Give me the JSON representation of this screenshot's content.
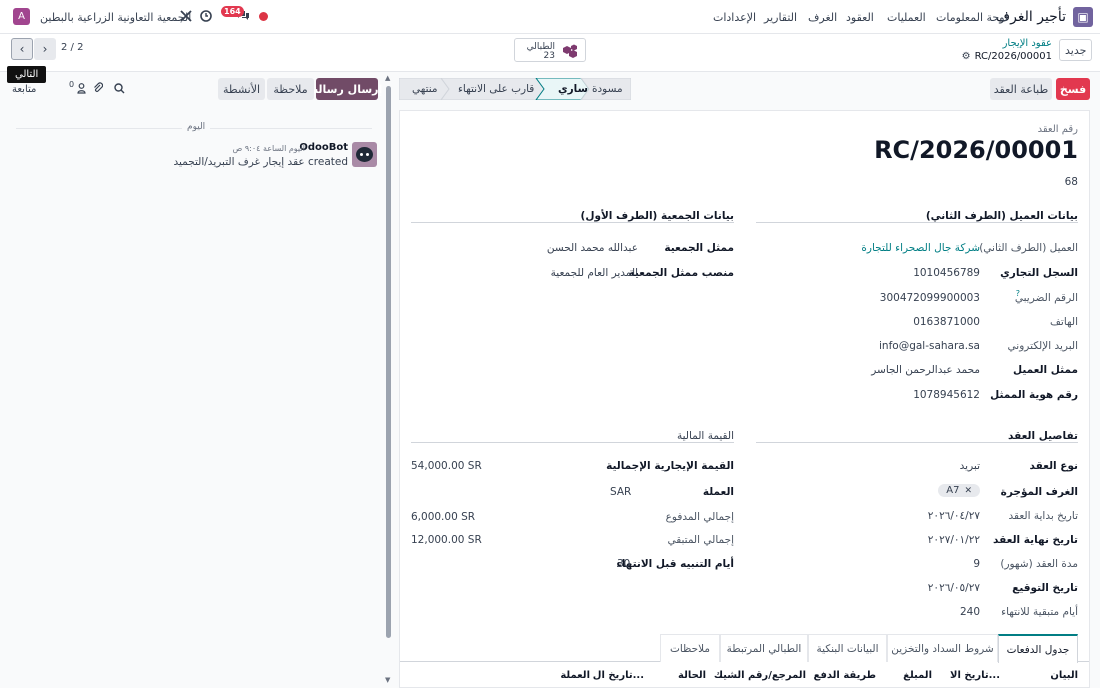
{
  "topbar": {
    "app_name": "تأجير الغرف",
    "menu": [
      "لوحة المعلومات",
      "العمليات",
      "العقود",
      "الغرف",
      "التقارير",
      "الإعدادات"
    ],
    "company": "الجمعية التعاونية الزراعية بالبطين",
    "user_initial": "A",
    "messages_count": "164"
  },
  "control": {
    "new_label": "جديد",
    "breadcrumb_parent": "عقود الإيجار",
    "record_name": "RC/2026/00001",
    "smart_button_label": "الطبالي",
    "smart_button_count": "23",
    "pager": "2 / 2",
    "tooltip": "التالي"
  },
  "actions": {
    "cancel": "فسخ",
    "print": "طباعة العقد",
    "stages": [
      "مسودة",
      "ساري",
      "قارب على الانتهاء",
      "منتهي"
    ],
    "active_stage": "ساري"
  },
  "chatter": {
    "send_message": "إرسال رسالة",
    "note": "ملاحظة",
    "activities": "الأنشطة",
    "follow": "متابعة",
    "followers_count": "0",
    "day_label": "اليوم",
    "author": "OdooBot",
    "time": "اليوم الساعة ٩:٠٤ ص",
    "message": "عقد إيجار غرف التبريد/التجميد created"
  },
  "form": {
    "number_label": "رقم العقد",
    "number": "RC/2026/00001",
    "sub_number": "68",
    "client_section": "بيانات العميل (الطرف الثاني)",
    "assoc_section": "بيانات الجمعية (الطرف الأول)",
    "client_fields": [
      {
        "label": "العميل (الطرف الثاني)",
        "value": "شركة جال الصحراء للتجارة",
        "bold": false
      },
      {
        "label": "السجل التجاري",
        "value": "1010456789",
        "bold": true
      },
      {
        "label": "الرقم الضريبي",
        "value": "300472099900003",
        "bold": false
      },
      {
        "label": "الهاتف",
        "value": "0163871000",
        "bold": false
      },
      {
        "label": "البريد الإلكتروني",
        "value": "info@gal-sahara.sa",
        "bold": false
      },
      {
        "label": "ممثل العميل",
        "value": "محمد عبدالرحمن الجاسر",
        "bold": true
      },
      {
        "label": "رقم هوية الممثل",
        "value": "1078945612",
        "bold": true
      }
    ],
    "tax_help": "?",
    "assoc_fields": [
      {
        "label": "ممثل الجمعية",
        "value": "عبدالله محمد الحسن"
      },
      {
        "label": "منصب ممثل الجمعية",
        "value": "المدير العام للجمعية"
      }
    ],
    "contract_section": "تفاصيل العقد",
    "finance_section": "القيمة المالية",
    "contract_fields": [
      {
        "label": "نوع العقد",
        "value": "تبريد",
        "bold": true
      },
      {
        "label": "الغرف المؤجرة",
        "value": "",
        "bold": true
      },
      {
        "label": "تاريخ بداية العقد",
        "value": "٢٠٢٦/٠٤/٢٧",
        "bold": false
      },
      {
        "label": "تاريخ نهاية العقد",
        "value": "٢٠٢٧/٠١/٢٢",
        "bold": true
      },
      {
        "label": "مدة العقد (شهور)",
        "value": "9",
        "bold": false
      },
      {
        "label": "تاريخ التوقيع",
        "value": "٢٠٢٦/٠٥/٢٧",
        "bold": true
      },
      {
        "label": "أيام متبقية للانتهاء",
        "value": "240",
        "bold": false
      }
    ],
    "room_tag": "A7",
    "finance_fields": [
      {
        "label": "القيمة الإيجارية الإجمالية",
        "value": "54,000.00 SR",
        "bold": true
      },
      {
        "label": "العملة",
        "value": "SAR",
        "bold": true
      },
      {
        "label": "إجمالي المدفوع",
        "value": "6,000.00 SR",
        "bold": false
      },
      {
        "label": "إجمالي المتبقي",
        "value": "12,000.00 SR",
        "bold": false
      },
      {
        "label": "أيام التنبيه قبل الانتهاء",
        "value": "30",
        "bold": true
      }
    ],
    "tabs": [
      "جدول الدفعات",
      "شروط السداد والتخزين",
      "البيانات البنكية",
      "الطبالي المرتبطة",
      "ملاحظات"
    ],
    "table_headers": [
      "البيان",
      "تاريخ الا...",
      "المبلغ",
      "طريقة الدفع",
      "المرجع/رقم الشيك",
      "الحالة",
      "تاريخ ال...",
      "العملة"
    ]
  }
}
